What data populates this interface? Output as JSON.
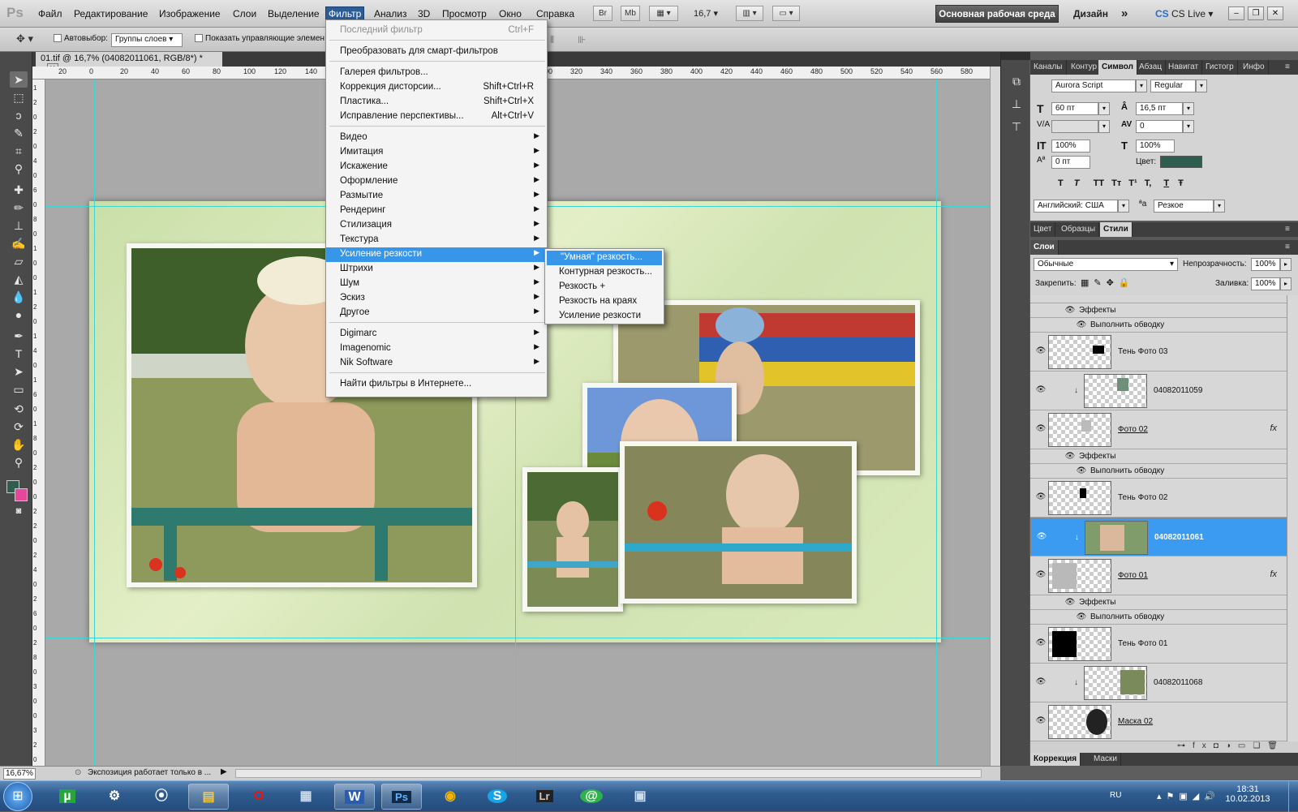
{
  "app": {
    "logo": "Ps"
  },
  "menubar": {
    "items": [
      "Файл",
      "Редактирование",
      "Изображение",
      "Слои",
      "Выделение",
      "Фильтр",
      "Анализ",
      "3D",
      "Просмотр",
      "Окно",
      "Справка"
    ],
    "active_index": 5,
    "buttons": {
      "br": "Br",
      "mb": "Mb"
    },
    "zoom": "16,7",
    "workspace": "Основная рабочая среда",
    "design": "Дизайн",
    "more": "»",
    "cslive": "CS Live"
  },
  "options": {
    "autoselect_label": "Автовыбор:",
    "autoselect_value": "Группы слоев",
    "show_controls_label": "Показать управляющие элемен"
  },
  "document": {
    "tab_title": "01.tif @ 16,7% (04082011061, RGB/8*) *",
    "ruler_h": [
      "20",
      "0",
      "20",
      "40",
      "60",
      "80",
      "100",
      "120",
      "140",
      "300",
      "320",
      "340",
      "360",
      "380",
      "400",
      "420",
      "440",
      "460",
      "480",
      "500",
      "520",
      "540",
      "560",
      "580"
    ],
    "ruler_v": [
      "1",
      "2",
      "0",
      "2",
      "0",
      "4",
      "0",
      "6",
      "0",
      "8",
      "0",
      "1",
      "0",
      "0",
      "1",
      "2",
      "0",
      "1",
      "4",
      "0",
      "1",
      "6",
      "0",
      "1",
      "8",
      "0",
      "2",
      "0",
      "0",
      "2",
      "2",
      "0",
      "2",
      "4",
      "0",
      "2",
      "6",
      "0",
      "2",
      "8",
      "0",
      "3",
      "0",
      "0",
      "3",
      "2",
      "0"
    ]
  },
  "filter_menu": {
    "items": [
      {
        "label": "Последний фильтр",
        "shortcut": "Ctrl+F",
        "disabled": true
      },
      {
        "label": "Преобразовать для смарт-фильтров"
      },
      {
        "label": "Галерея фильтров..."
      },
      {
        "label": "Коррекция дисторсии...",
        "shortcut": "Shift+Ctrl+R"
      },
      {
        "label": "Пластика...",
        "shortcut": "Shift+Ctrl+X"
      },
      {
        "label": "Исправление перспективы...",
        "shortcut": "Alt+Ctrl+V"
      },
      {
        "label": "Видео",
        "submenu": true
      },
      {
        "label": "Имитация",
        "submenu": true
      },
      {
        "label": "Искажение",
        "submenu": true
      },
      {
        "label": "Оформление",
        "submenu": true
      },
      {
        "label": "Размытие",
        "submenu": true
      },
      {
        "label": "Рендеринг",
        "submenu": true
      },
      {
        "label": "Стилизация",
        "submenu": true
      },
      {
        "label": "Текстура",
        "submenu": true
      },
      {
        "label": "Усиление резкости",
        "submenu": true,
        "highlighted": true
      },
      {
        "label": "Штрихи",
        "submenu": true
      },
      {
        "label": "Шум",
        "submenu": true
      },
      {
        "label": "Эскиз",
        "submenu": true
      },
      {
        "label": "Другое",
        "submenu": true
      },
      {
        "label": "Digimarc",
        "submenu": true
      },
      {
        "label": "Imagenomic",
        "submenu": true
      },
      {
        "label": "Nik Software",
        "submenu": true
      },
      {
        "label": "Найти фильтры в Интернете..."
      }
    ],
    "submenu_items": [
      "\"Умная\" резкость...",
      "Контурная резкость...",
      "Резкость +",
      "Резкость на краях",
      "Усиление резкости"
    ]
  },
  "character_panel": {
    "tabs": [
      "Каналы",
      "Контур",
      "Символ",
      "Абзац",
      "Навигат",
      "Гистогр",
      "Инфо"
    ],
    "active_tab": 2,
    "font_family": "Aurora Script",
    "font_style": "Regular",
    "font_size": "60 пт",
    "leading": "16,5 пт",
    "kerning": "",
    "tracking": "0",
    "vscale": "100%",
    "hscale": "100%",
    "baseline": "0 пт",
    "color_label": "Цвет:",
    "color": "#2f5d4f",
    "style_buttons": [
      "T",
      "T",
      "TT",
      "Tт",
      "T¹",
      "T,",
      "T",
      "Ŧ"
    ],
    "language": "Английский: США",
    "aa_label": "ªa",
    "antialias": "Резкое"
  },
  "styles_tabs": {
    "tabs": [
      "Цвет",
      "Образцы",
      "Стили"
    ],
    "active": 2
  },
  "layers_panel": {
    "tab": "Слои",
    "blend_mode": "Обычные",
    "opacity_label": "Непрозрачность:",
    "opacity": "100%",
    "lock_label": "Закрепить:",
    "fill_label": "Заливка:",
    "fill": "100%",
    "effects_label": "Эффекты",
    "stroke_label": "Выполнить обводку",
    "layers": [
      {
        "name": "Тень Фото 03"
      },
      {
        "name": "04082011059"
      },
      {
        "name": "Фото 02"
      },
      {
        "name": "Тень Фото 02"
      },
      {
        "name": "04082011061"
      },
      {
        "name": "Фото 01"
      },
      {
        "name": "Тень Фото 01"
      },
      {
        "name": "04082011068"
      },
      {
        "name": "Маска 02"
      }
    ],
    "fx": "fx",
    "bottom_tabs": [
      "Коррекция",
      "Маски"
    ]
  },
  "status": {
    "zoom": "16,67%",
    "message": "Экспозиция работает только в ..."
  },
  "taskbar": {
    "apps": [
      "µ",
      "⚙",
      "⦿",
      "▤",
      "O",
      "▦",
      "W",
      "Ps",
      "◉",
      "S",
      "Lr",
      "@",
      "▣"
    ],
    "lang": "RU",
    "time": "18:31",
    "date": "10.02.2013"
  },
  "colors": {
    "menu_highlight": "#3796e8",
    "layer_selected": "#3a9bf0",
    "foreground": "#2f5d4f",
    "background": "#e6479a"
  }
}
